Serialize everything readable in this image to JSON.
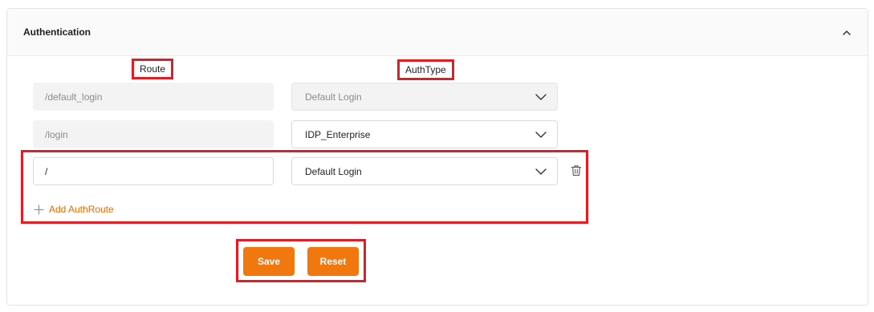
{
  "section": {
    "title": "Authentication"
  },
  "columns": {
    "route_label": "Route",
    "authtype_label": "AuthType"
  },
  "routes": [
    {
      "route": "/default_login",
      "auth_type": "Default Login",
      "disabled": true
    },
    {
      "route": "/login",
      "auth_type": "IDP_Enterprise",
      "disabled": false
    },
    {
      "route": "/",
      "auth_type": "Default Login",
      "disabled": false
    }
  ],
  "add_route_label": "Add AuthRoute",
  "buttons": {
    "save": "Save",
    "reset": "Reset"
  },
  "colors": {
    "accent": "#f0780f",
    "link": "#e86a00",
    "highlight": "#e31b23"
  },
  "icons": {
    "collapse": "chevron-up-icon",
    "dropdown": "chevron-down-icon",
    "delete": "trash-icon",
    "add": "plus-icon"
  }
}
